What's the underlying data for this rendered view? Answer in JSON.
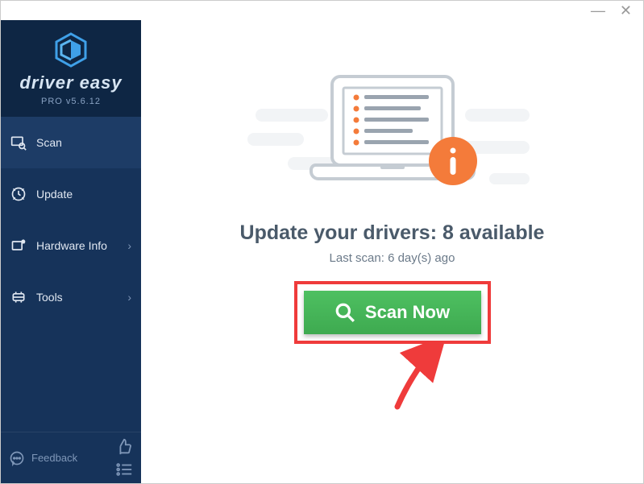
{
  "brand": {
    "name": "driver easy",
    "version": "PRO v5.6.12"
  },
  "nav": {
    "scan": "Scan",
    "update": "Update",
    "hardware": "Hardware Info",
    "tools": "Tools"
  },
  "footer": {
    "feedback": "Feedback"
  },
  "main": {
    "title": "Update your drivers: 8 available",
    "subtitle": "Last scan: 6 day(s) ago",
    "scan_button": "Scan Now"
  }
}
